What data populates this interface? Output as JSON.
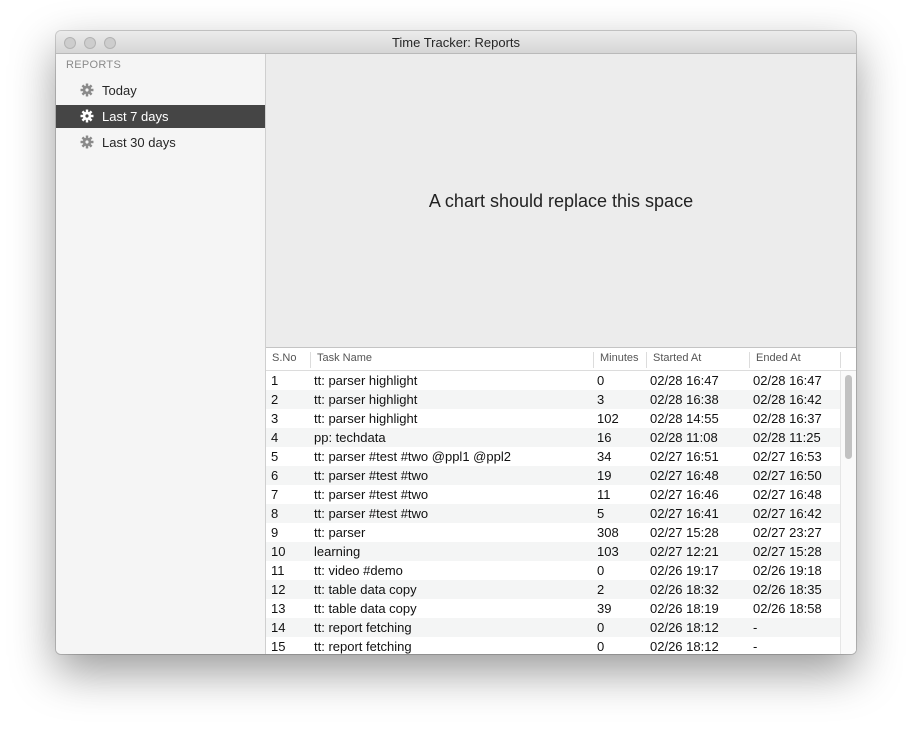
{
  "window": {
    "title": "Time Tracker: Reports"
  },
  "sidebar": {
    "section_label": "REPORTS",
    "items": [
      {
        "label": "Today",
        "icon": "gear-icon",
        "selected": false
      },
      {
        "label": "Last 7 days",
        "icon": "gear-icon",
        "selected": true
      },
      {
        "label": "Last 30 days",
        "icon": "gear-icon",
        "selected": false
      }
    ]
  },
  "chart_area": {
    "placeholder_text": "A chart should replace this space"
  },
  "table": {
    "columns": [
      "S.No",
      "Task Name",
      "Minutes",
      "Started At",
      "Ended At"
    ],
    "rows": [
      [
        "1",
        "tt: parser highlight",
        "0",
        "02/28 16:47",
        "02/28 16:47"
      ],
      [
        "2",
        "tt: parser highlight",
        "3",
        "02/28 16:38",
        "02/28 16:42"
      ],
      [
        "3",
        "tt: parser highlight",
        "102",
        "02/28 14:55",
        "02/28 16:37"
      ],
      [
        "4",
        "pp: techdata",
        "16",
        "02/28 11:08",
        "02/28 11:25"
      ],
      [
        "5",
        "tt: parser #test #two @ppl1 @ppl2",
        "34",
        "02/27 16:51",
        "02/27 16:53"
      ],
      [
        "6",
        "tt: parser #test #two",
        "19",
        "02/27 16:48",
        "02/27 16:50"
      ],
      [
        "7",
        "tt: parser #test #two",
        "11",
        "02/27 16:46",
        "02/27 16:48"
      ],
      [
        "8",
        "tt: parser #test #two",
        "5",
        "02/27 16:41",
        "02/27 16:42"
      ],
      [
        "9",
        "tt: parser",
        "308",
        "02/27 15:28",
        "02/27 23:27"
      ],
      [
        "10",
        "learning",
        "103",
        "02/27 12:21",
        "02/27 15:28"
      ],
      [
        "11",
        "tt: video #demo",
        "0",
        "02/26 19:17",
        "02/26 19:18"
      ],
      [
        "12",
        "tt: table data copy",
        "2",
        "02/26 18:32",
        "02/26 18:35"
      ],
      [
        "13",
        "tt: table data copy",
        "39",
        "02/26 18:19",
        "02/26 18:58"
      ],
      [
        "14",
        "tt: report fetching",
        "0",
        "02/26 18:12",
        "-"
      ],
      [
        "15",
        "tt: report fetching",
        "0",
        "02/26 18:12",
        "-"
      ]
    ]
  },
  "colors": {
    "selection_bg": "#454545",
    "selection_text": "#ffffff",
    "sidebar_bg": "#f5f5f5",
    "window_bg": "#ececec"
  }
}
